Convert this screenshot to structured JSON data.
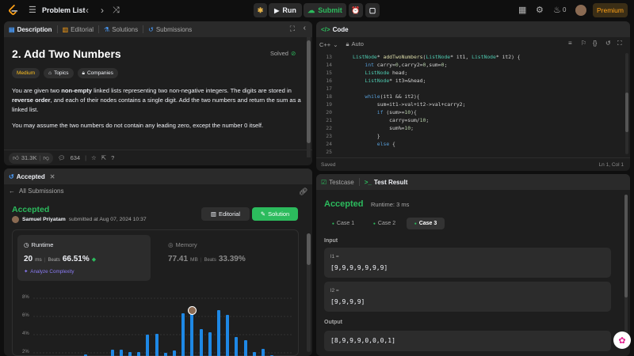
{
  "topbar": {
    "problem_list": "Problem List",
    "run": "Run",
    "submit": "Submit",
    "streak": "0",
    "premium": "Premium"
  },
  "description": {
    "tabs": [
      "Description",
      "Editorial",
      "Solutions",
      "Submissions"
    ],
    "title": "2. Add Two Numbers",
    "solved": "Solved",
    "difficulty": "Medium",
    "topics": "Topics",
    "companies": "Companies",
    "p1_a": "You are given two ",
    "p1_b": "non-empty",
    "p1_c": " linked lists representing two non-negative integers. The digits are stored in ",
    "p1_d": "reverse order",
    "p1_e": ", and each of their nodes contains a single digit. Add the two numbers and return the sum as a linked list.",
    "p2": "You may assume the two numbers do not contain any leading zero, except the number 0 itself.",
    "likes": "31.3K",
    "comments": "634"
  },
  "accepted_panel": {
    "tab": "Accepted",
    "back": "All Submissions",
    "status": "Accepted",
    "user": "Samuel Priyatam",
    "submitted": "submitted at Aug 07, 2024 10:37",
    "editorial": "Editorial",
    "solution": "Solution",
    "runtime_label": "Runtime",
    "runtime_value": "20",
    "runtime_unit": "ms",
    "beats_label": "Beats",
    "runtime_beats": "66.51%",
    "analyze": "Analyze Complexity",
    "memory_label": "Memory",
    "memory_value": "77.41",
    "memory_unit": "MB",
    "memory_beats": "33.39%",
    "y_ticks": [
      "8%",
      "6%",
      "4%",
      "2%"
    ]
  },
  "chart_data": {
    "type": "bar",
    "ylim": [
      0,
      9
    ],
    "y_ticks": [
      "8%",
      "6%",
      "4%",
      "2%"
    ],
    "values": [
      0.2,
      0.3,
      0.4,
      0.5,
      0.7,
      0.9,
      0.5,
      0.3,
      1.5,
      1.5,
      1.2,
      1.2,
      3.5,
      3.6,
      1.1,
      1.4,
      6.2,
      6.4,
      4.2,
      3.8,
      6.6,
      6.0,
      3.2,
      2.8,
      1.2,
      1.6,
      0.8,
      0.5
    ],
    "highlight_index": 17,
    "bar_color": "#1e88e5"
  },
  "code_panel": {
    "title": "Code",
    "language": "C++",
    "auto": "Auto",
    "saved": "Saved",
    "cursor": "Ln 1, Col 1",
    "line_numbers": [
      "13",
      "14",
      "15",
      "16",
      "17",
      "18",
      "19",
      "20",
      "21",
      "22",
      "23",
      "24",
      "25"
    ]
  },
  "test_panel": {
    "tabs": [
      "Testcase",
      "Test Result"
    ],
    "status": "Accepted",
    "runtime": "Runtime: 3 ms",
    "cases": [
      "Case 1",
      "Case 2",
      "Case 3"
    ],
    "input_label": "Input",
    "l1_label": "l1 =",
    "l1_value": "[9,9,9,9,9,9,9]",
    "l2_label": "l2 =",
    "l2_value": "[9,9,9,9]",
    "output_label": "Output",
    "output_value": "[8,9,9,9,0,0,0,1]"
  },
  "colors": {
    "accent_green": "#2cbb5d",
    "accent_orange": "#ffa116",
    "medium_tag": "#ffc01e",
    "bar_blue": "#1e88e5"
  }
}
